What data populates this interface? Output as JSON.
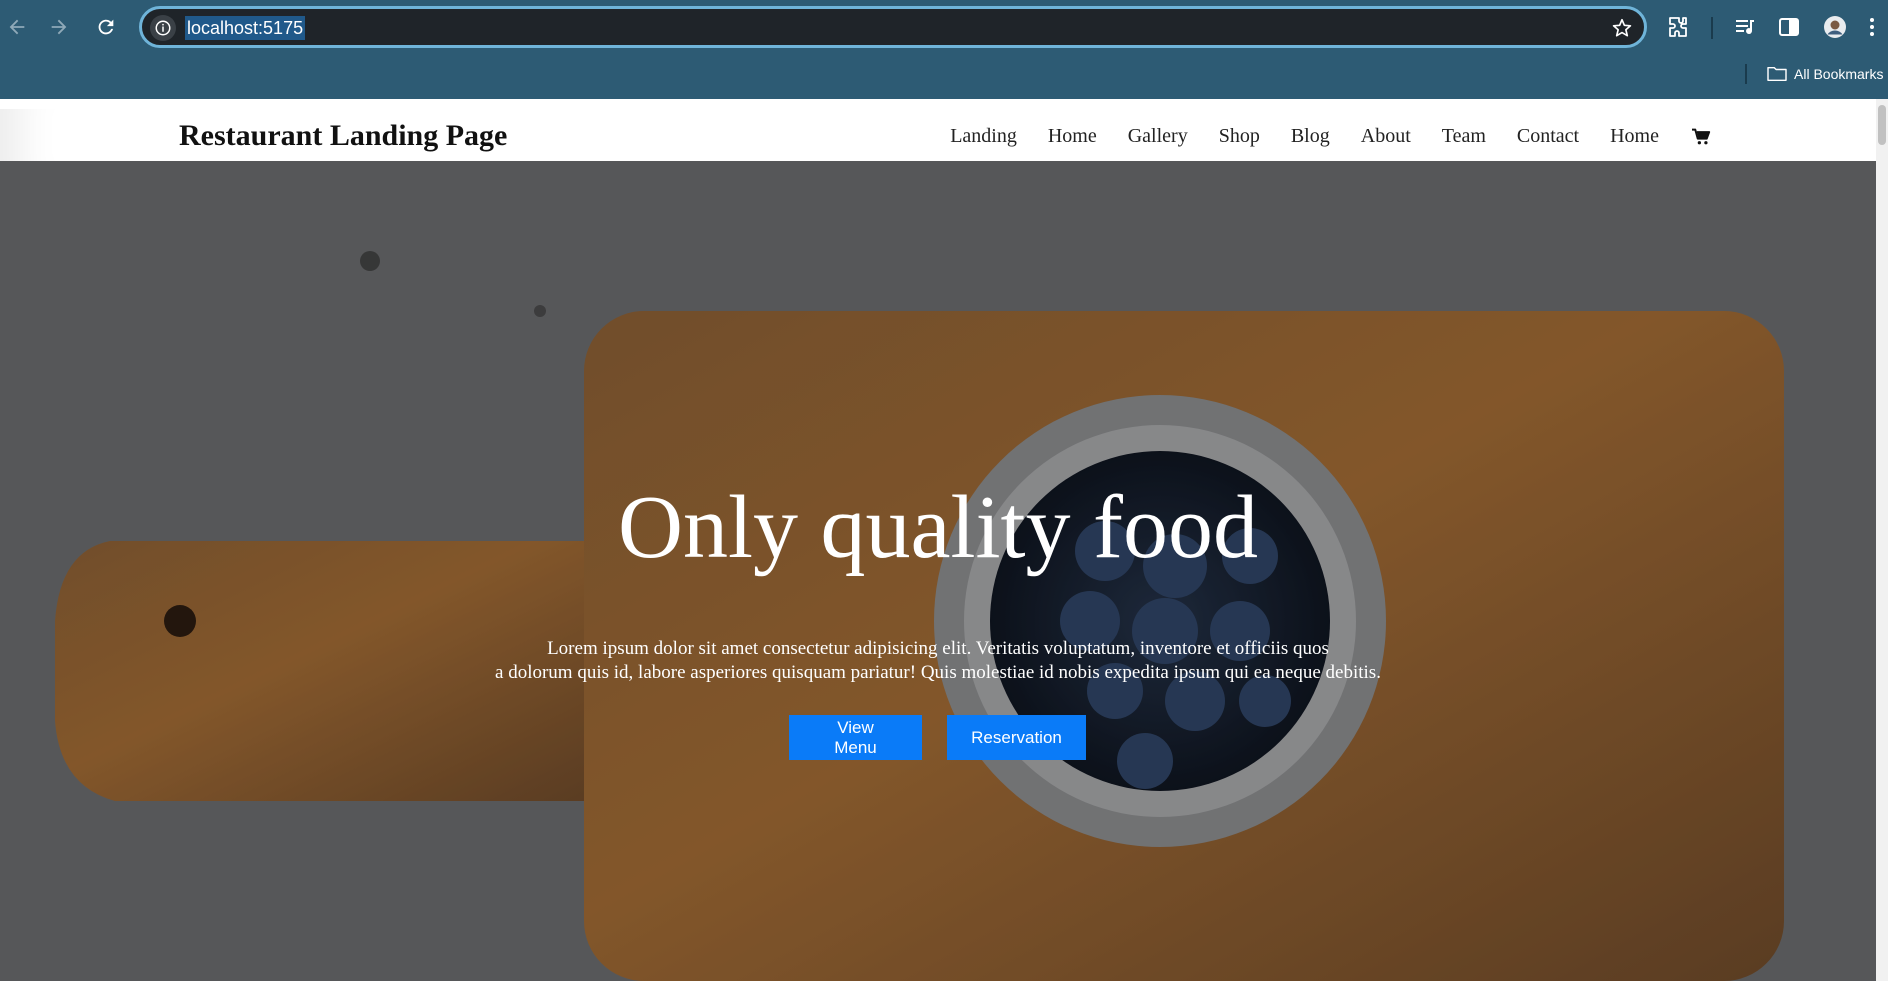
{
  "browser": {
    "url": "localhost:5175",
    "bookmarks_label": "All Bookmarks",
    "icons": [
      "back-arrow-icon",
      "forward-arrow-icon",
      "reload-icon",
      "site-info-icon",
      "star-icon",
      "extensions-icon",
      "media-control-icon",
      "side-panel-icon",
      "profile-avatar-icon",
      "more-menu-icon",
      "folder-icon"
    ],
    "colors": {
      "toolbar": "#2d5b74",
      "omnibox": "#1f2429",
      "omnibox_border": "#6fb4d9"
    }
  },
  "site": {
    "brand": "Restaurant Landing Page",
    "nav": [
      "Landing",
      "Home",
      "Gallery",
      "Shop",
      "Blog",
      "About",
      "Team",
      "Contact",
      "Home"
    ],
    "cart_icon": "shopping-cart-icon"
  },
  "hero": {
    "title": "Only quality food",
    "text_line1": "Lorem ipsum dolor sit amet consectetur adipisicing elit. Veritatis voluptatum, inventore et officiis quos",
    "text_line2": "a dolorum quis id, labore asperiores quisquam pariatur! Quis molestiae id nobis expedita ipsum qui ea neque debitis.",
    "buttons": [
      "View Menu",
      "Reservation"
    ],
    "button_color": "#0a7bf8",
    "background_image": "cutting board with bowl of blueberries"
  }
}
